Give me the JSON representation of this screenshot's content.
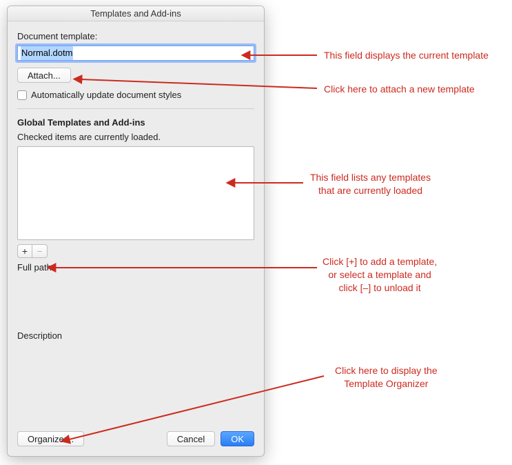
{
  "dialog": {
    "title": "Templates and Add-ins",
    "document_template_label": "Document template:",
    "document_template_value": "Normal.dotm",
    "attach_button": "Attach...",
    "auto_update_label": "Automatically update document styles",
    "auto_update_checked": false,
    "global_section_title": "Global Templates and Add-ins",
    "global_section_subtitle": "Checked items are currently loaded.",
    "add_button_glyph": "+",
    "remove_button_glyph": "−",
    "full_path_label": "Full path:",
    "full_path_value": "",
    "description_label": "Description",
    "organizer_button": "Organizer...",
    "cancel_button": "Cancel",
    "ok_button": "OK"
  },
  "annotations": {
    "a1": "This field displays the current template",
    "a2": "Click here to attach a new template",
    "a3_line1": "This field lists any templates",
    "a3_line2": "that are currently loaded",
    "a4_line1": "Click [+] to add a template,",
    "a4_line2": "or select a template and",
    "a4_line3": "click [–] to unload it",
    "a5_line1": "Click here to display the",
    "a5_line2": "Template Organizer"
  }
}
